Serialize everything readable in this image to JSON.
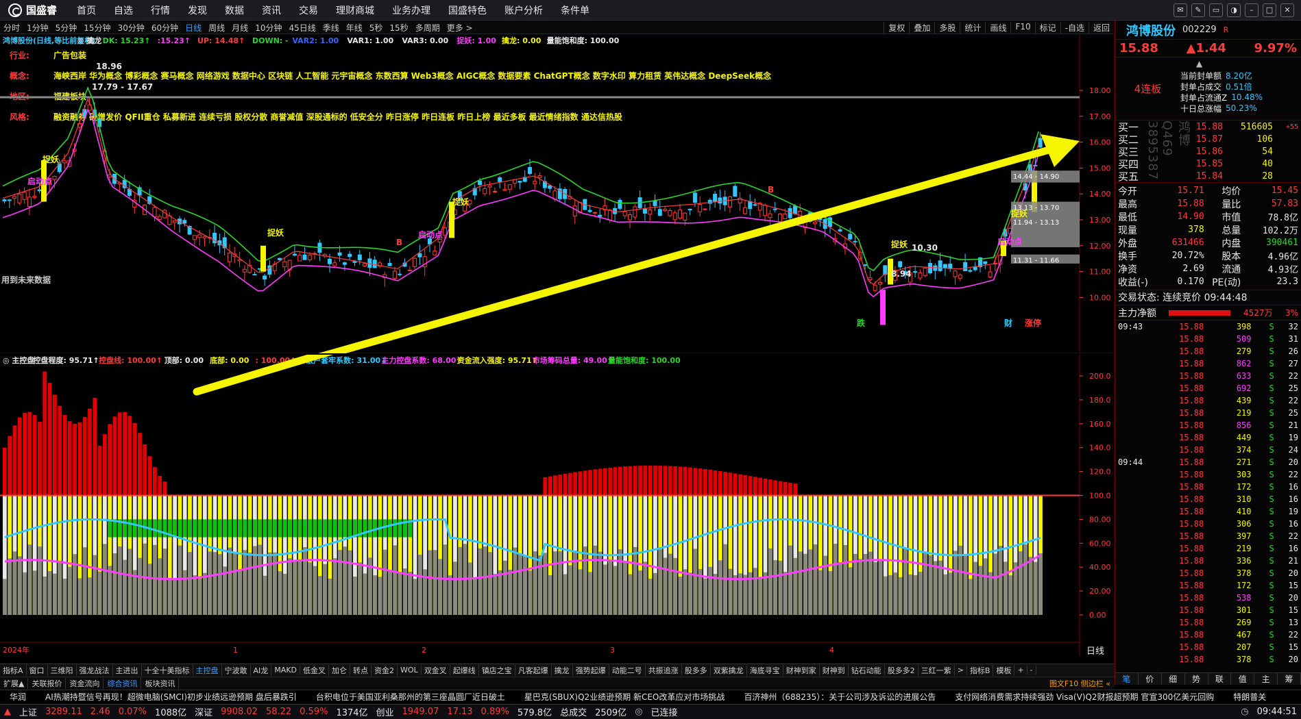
{
  "app": {
    "logo": "国盛睿",
    "nav": [
      "首页",
      "自选",
      "行情",
      "发现",
      "数据",
      "资讯",
      "交易",
      "理财商城",
      "业务办理",
      "国盛特色",
      "账户分析",
      "条件单"
    ]
  },
  "periods": [
    "分时",
    "1分钟",
    "5分钟",
    "15分钟",
    "30分钟",
    "60分钟",
    "日线",
    "周线",
    "月线",
    "10分钟",
    "45日线",
    "季线",
    "年线",
    "5秒",
    "15秒",
    "多周期",
    "更多 >"
  ],
  "active_period": "日线",
  "right_tools": [
    "复权",
    "叠加",
    "多股",
    "统计",
    "画线",
    "F10",
    "标记",
    "-自选",
    "返回"
  ],
  "main_legend": [
    {
      "text": "鸿博股份(日线,等比前复权)",
      "color": "#32c8ff"
    },
    {
      "text": "◎ 擒龙",
      "color": "#e8e8e8"
    },
    {
      "text": "DK: 15.23↑",
      "color": "#2fd32f"
    },
    {
      "text": ":15.23↑",
      "color": "#ff3cff"
    },
    {
      "text": "UP: 14.48↑",
      "color": "#ff3c3c"
    },
    {
      "text": "DOWN: -",
      "color": "#2fd32f"
    },
    {
      "text": "VAR2: 1.00",
      "color": "#3c64ff"
    },
    {
      "text": "VAR1: 1.00",
      "color": "#e8e8e8"
    },
    {
      "text": "VAR3: 0.00",
      "color": "#e8e8e8"
    },
    {
      "text": "捉妖: 1.00",
      "color": "#ff3cff"
    },
    {
      "text": "擒龙: 0.00",
      "color": "#f5f500"
    },
    {
      "text": "量能饱和度: 100.00",
      "color": "#e8e8e8"
    }
  ],
  "info_rows": [
    {
      "label": "行业:",
      "value": "广告包装"
    },
    {
      "label": "概念:",
      "value": "海峡西岸 华为概念 博彩概念 赛马概念 网络游戏 数据中心 区块链 人工智能 元宇宙概念 东数西算 Web3概念 AIGC概念 数据要素 ChatGPT概念 数字水印 算力租赁 英伟达概念 DeepSeek概念"
    },
    {
      "label": "地区:",
      "value": "福建板块"
    },
    {
      "label": "风格:",
      "value": "融资融券 破增发价 QFII重仓 私募新进 连续亏损 股权分散 商誉减值 深股通标的 低安全分 昨日涨停 昨日连板 昨日上榜 最近多板 最近情绪指数 通达信热股"
    }
  ],
  "price_axis": [
    "18.00",
    "17.00",
    "16.00",
    "15.00",
    "14.00",
    "13.00",
    "12.00",
    "11.00",
    "10.00"
  ],
  "sub_axis": [
    "200.0",
    "180.0",
    "160.0",
    "140.0",
    "120.0",
    "100.0",
    "80.00",
    "60.00",
    "40.00",
    "20.00",
    "0.00"
  ],
  "date_axis": [
    "2024年",
    "1",
    "2",
    "3",
    "4"
  ],
  "annotations": {
    "zhuoyao": "捉妖",
    "qidong": "启动点",
    "b": "B",
    "high_price": "18.96",
    "range_top": "17.79 - 17.67",
    "low_price": "8.94",
    "price_1030": "10.30",
    "zones": [
      "14.44 - 14.90",
      "13.13 - 13.70",
      "11.94 - 13.13",
      "11.31 - 11.66"
    ],
    "future_note": "用到未来数据",
    "die": "跌",
    "cai": "财",
    "zhangting": "涨停"
  },
  "sub_legend": [
    {
      "text": "◎ 主控盘",
      "color": "#e8e8e8"
    },
    {
      "text": "控盘程度: 95.71↑",
      "color": "#e8e8e8"
    },
    {
      "text": "控盘线: 100.00↑",
      "color": "#ff3c3c"
    },
    {
      "text": "顶部: 0.00",
      "color": "#e8e8e8"
    },
    {
      "text": "底部: 0.00",
      "color": "#f5f500"
    },
    {
      "text": ": 100.00↑",
      "color": "#ff3c3c"
    },
    {
      "text": "散户套牢系数: 31.00↓",
      "color": "#32c8ff"
    },
    {
      "text": "主力控盘系数: 68.00↑",
      "color": "#ff3cff"
    },
    {
      "text": "资金流入强度: 95.71↑",
      "color": "#f5f500"
    },
    {
      "text": "市场筹码总量: 49.00↑",
      "color": "#ff3cff"
    },
    {
      "text": "量能饱和度: 100.00",
      "color": "#2fd32f"
    }
  ],
  "sub_period_label": "日线",
  "quote": {
    "name": "鸿博股份",
    "code": "002229",
    "tag": "R",
    "price": "15.88",
    "change": "▲1.44",
    "change_pct": "9.97%",
    "streak": "4连板",
    "seal": [
      {
        "label": "当前封单额",
        "value": "8.20亿"
      },
      {
        "label": "封单占成交",
        "value": "0.51倍"
      },
      {
        "label": "封单占流通Z",
        "value": "10.48%"
      },
      {
        "label": "十日总涨幅",
        "value": "50.23%"
      }
    ],
    "bids": [
      {
        "label": "买一",
        "price": "15.88",
        "vol": "516605",
        "extra": "+55"
      },
      {
        "label": "买二",
        "price": "15.87",
        "vol": "106",
        "extra": ""
      },
      {
        "label": "买三",
        "price": "15.86",
        "vol": "54",
        "extra": ""
      },
      {
        "label": "买四",
        "price": "15.85",
        "vol": "40",
        "extra": ""
      },
      {
        "label": "买五",
        "price": "15.84",
        "vol": "28",
        "extra": ""
      }
    ],
    "watermark": "鸿博Q469 3895387",
    "stats": [
      {
        "l1": "今开",
        "v1": "15.71",
        "c1": "red",
        "l2": "均价",
        "v2": "15.45",
        "c2": "red"
      },
      {
        "l1": "最高",
        "v1": "15.88",
        "c1": "red",
        "l2": "量比",
        "v2": "57.83",
        "c2": "red"
      },
      {
        "l1": "最低",
        "v1": "14.90",
        "c1": "red",
        "l2": "市值",
        "v2": "78.8亿",
        "c2": "white"
      },
      {
        "l1": "现量",
        "v1": "378",
        "c1": "yellow",
        "l2": "总量",
        "v2": "102.2万",
        "c2": "white"
      },
      {
        "l1": "外盘",
        "v1": "631466",
        "c1": "red",
        "l2": "内盘",
        "v2": "390461",
        "c2": "green"
      },
      {
        "l1": "换手",
        "v1": "20.72%",
        "c1": "white",
        "l2": "股本",
        "v2": "4.96亿",
        "c2": "white"
      },
      {
        "l1": "净资",
        "v1": "2.69",
        "c1": "white",
        "l2": "流通",
        "v2": "4.93亿",
        "c2": "white"
      },
      {
        "l1": "收益(-)",
        "v1": "0.170",
        "c1": "white",
        "l2": "PE(动)",
        "v2": "23.3",
        "c2": "white"
      }
    ],
    "trade_state": "交易状态: 连续竞价 09:44:48",
    "main_flow_label": "主力净额",
    "main_flow_value": "4527万",
    "main_flow_pct": "3%",
    "ticks": [
      {
        "time": "09:43",
        "price": "15.88",
        "vol": "398",
        "side": "S",
        "n": "32"
      },
      {
        "time": "",
        "price": "15.88",
        "vol": "509",
        "side": "S",
        "n": "31"
      },
      {
        "time": "",
        "price": "15.88",
        "vol": "279",
        "side": "S",
        "n": "26"
      },
      {
        "time": "",
        "price": "15.88",
        "vol": "862",
        "side": "S",
        "n": "27"
      },
      {
        "time": "",
        "price": "15.88",
        "vol": "633",
        "side": "S",
        "n": "22"
      },
      {
        "time": "",
        "price": "15.88",
        "vol": "692",
        "side": "S",
        "n": "25"
      },
      {
        "time": "",
        "price": "15.88",
        "vol": "439",
        "side": "S",
        "n": "22"
      },
      {
        "time": "",
        "price": "15.88",
        "vol": "219",
        "side": "S",
        "n": "25"
      },
      {
        "time": "",
        "price": "15.88",
        "vol": "856",
        "side": "S",
        "n": "21"
      },
      {
        "time": "",
        "price": "15.88",
        "vol": "449",
        "side": "S",
        "n": "19"
      },
      {
        "time": "",
        "price": "15.88",
        "vol": "374",
        "side": "S",
        "n": "24"
      },
      {
        "time": "09:44",
        "price": "15.88",
        "vol": "271",
        "side": "S",
        "n": "20"
      },
      {
        "time": "",
        "price": "15.88",
        "vol": "303",
        "side": "S",
        "n": "22"
      },
      {
        "time": "",
        "price": "15.88",
        "vol": "172",
        "side": "S",
        "n": "16"
      },
      {
        "time": "",
        "price": "15.88",
        "vol": "310",
        "side": "S",
        "n": "16"
      },
      {
        "time": "",
        "price": "15.88",
        "vol": "410",
        "side": "S",
        "n": "19"
      },
      {
        "time": "",
        "price": "15.88",
        "vol": "306",
        "side": "S",
        "n": "16"
      },
      {
        "time": "",
        "price": "15.88",
        "vol": "397",
        "side": "S",
        "n": "22"
      },
      {
        "time": "",
        "price": "15.88",
        "vol": "219",
        "side": "S",
        "n": "16"
      },
      {
        "time": "",
        "price": "15.88",
        "vol": "336",
        "side": "S",
        "n": "21"
      },
      {
        "time": "",
        "price": "15.88",
        "vol": "378",
        "side": "S",
        "n": "20"
      },
      {
        "time": "",
        "price": "15.88",
        "vol": "172",
        "side": "S",
        "n": "15"
      },
      {
        "time": "",
        "price": "15.88",
        "vol": "538",
        "side": "S",
        "n": "20"
      },
      {
        "time": "",
        "price": "15.88",
        "vol": "301",
        "side": "S",
        "n": "15"
      },
      {
        "time": "",
        "price": "15.88",
        "vol": "269",
        "side": "S",
        "n": "13"
      },
      {
        "time": "",
        "price": "15.88",
        "vol": "467",
        "side": "S",
        "n": "22"
      },
      {
        "time": "",
        "price": "15.88",
        "vol": "207",
        "side": "S",
        "n": "15"
      },
      {
        "time": "",
        "price": "15.88",
        "vol": "378",
        "side": "S",
        "n": "20"
      }
    ],
    "bottom_tabs": [
      "笔",
      "价",
      "细",
      "势",
      "联",
      "值",
      "主",
      "筹"
    ]
  },
  "tabs1": [
    "指标A",
    "窗口",
    "三维阳",
    "强龙战法",
    "主进出",
    "十全十美指标",
    "主控盘",
    "宁波敢",
    "AI龙",
    "MAKD",
    "低金叉",
    "加仑",
    "转点",
    "资金2",
    "WOL",
    "双金叉",
    "起爆线",
    "镇店之宝",
    "凡客起爆",
    "擒龙",
    "强势起爆",
    "动能二号",
    "共振追涨",
    "股多多",
    "双紫擒龙",
    "海底寻宝",
    "财神到家",
    "财神到",
    "钻石动能",
    "股多多2",
    "三红一紫",
    ">",
    "指标B",
    "模板",
    "+",
    "-"
  ],
  "active_tab1": "主控盘",
  "tabs2": [
    "扩展▲",
    "关联报价",
    "资金流向",
    "综合资讯",
    "板块资讯"
  ],
  "active_tab2": "综合资讯",
  "side_tabs": "图文F10 侧边栏 «",
  "news": [
    "华润",
    "AI热潮持暨信号再现！超微电脑(SMCI)初步业绩远逊预期 盘后暴跌引",
    "台积电位于美国亚利桑那州的第三座晶圆厂近日破土",
    "星巴克(SBUX)Q2业绩逊预期 新CEO改革应对市场挑战",
    "百济神州（688235）：关于公司涉及诉讼的进展公告",
    "支付网络消费需求持续强劲 Visa(V)Q2财报超预期 官宣300亿美元回购",
    "特朗普关"
  ],
  "status": {
    "sh_label": "上证",
    "sh_val": "3289.11",
    "sh_chg": "2.46",
    "sh_pct": "0.07%",
    "sh_amt": "1088亿",
    "sz_label": "深证",
    "sz_val": "9908.02",
    "sz_chg": "58.22",
    "sz_pct": "0.59%",
    "sz_amt": "1374亿",
    "cy_label": "创业",
    "cy_val": "1949.07",
    "cy_chg": "17.13",
    "cy_pct": "0.89%",
    "cy_amt": "579.8亿",
    "total_label": "总成交",
    "total_val": "2509亿",
    "conn": "已连接",
    "time": "09:44:51"
  }
}
